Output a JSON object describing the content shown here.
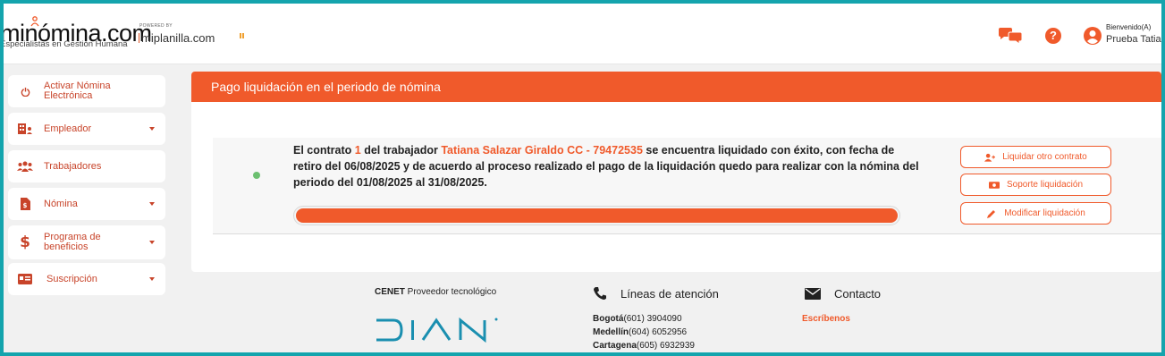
{
  "header": {
    "logo_text": "minómina.com",
    "logo_subtitle": "Especialistas en Gestión Humana",
    "powered_by": "POWERED BY",
    "partner": "miplanilla.com",
    "welcome": "Bienvenido(A)",
    "username": "Prueba Tatiana"
  },
  "sidebar": {
    "items": [
      {
        "label": "Activar Nómina Electrónica",
        "icon": "power-icon",
        "caret": false
      },
      {
        "label": "Empleador",
        "icon": "building-icon",
        "caret": true
      },
      {
        "label": "Trabajadores",
        "icon": "users-icon",
        "caret": false
      },
      {
        "label": "Nómina",
        "icon": "document-icon",
        "caret": true
      },
      {
        "label": "Programa de beneficios",
        "icon": "dollar-icon",
        "caret": true
      },
      {
        "label": "Suscripción",
        "icon": "card-icon",
        "caret": true
      }
    ]
  },
  "main": {
    "title": "Pago liquidación en el periodo de nómina",
    "message": {
      "p1": "El contrato ",
      "contract": "1",
      "p2": " del trabajador ",
      "worker": "Tatiana Salazar Giraldo CC - 79472535",
      "p3": " se encuentra liquidado con éxito, con fecha de retiro del 06/08/2025 y de acuerdo al proceso realizado el pago de la liquidación quedo para realizar con la nómina del periodo del 01/08/2025 al 31/08/2025."
    },
    "progress_percent": 100,
    "buttons": {
      "liquidate_other": "Liquidar otro contrato",
      "support": "Soporte liquidación",
      "modify": "Modificar liquidación"
    }
  },
  "footer": {
    "provider_bold": "CENET",
    "provider_rest": " Proveedor tecnológico",
    "dian_logo": "DIAN",
    "lines_title": "Líneas de atención",
    "cities": [
      {
        "city": "Bogotá",
        "phone": "(601) 3904090"
      },
      {
        "city": "Medellín",
        "phone": "(604) 6052956"
      },
      {
        "city": "Cartagena",
        "phone": "(605) 6932939"
      }
    ],
    "contact_title": "Contacto",
    "write_us": "Escríbenos"
  },
  "colors": {
    "accent": "#f05a2b",
    "frame": "#14a4ad",
    "background": "#f1f1f1"
  }
}
